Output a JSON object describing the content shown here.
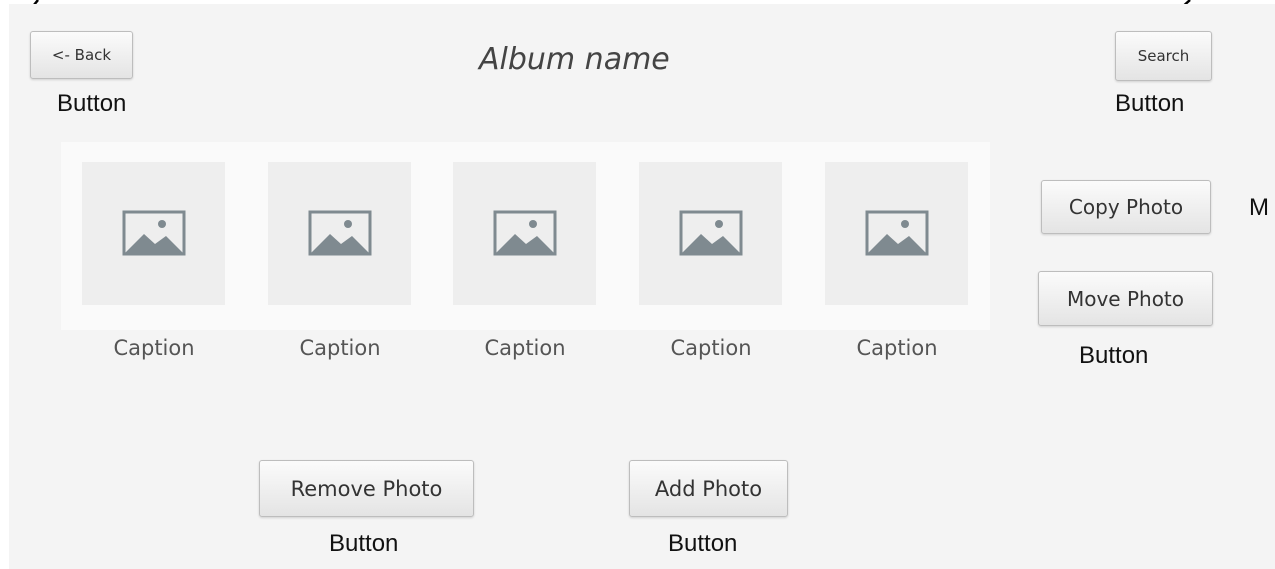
{
  "header": {
    "back_label": "<- Back",
    "title": "Album name",
    "search_label": "Search"
  },
  "photos": [
    {
      "caption": "Caption"
    },
    {
      "caption": "Caption"
    },
    {
      "caption": "Caption"
    },
    {
      "caption": "Caption"
    },
    {
      "caption": "Caption"
    }
  ],
  "actions": {
    "copy_label": "Copy Photo",
    "move_label": "Move Photo",
    "remove_label": "Remove Photo",
    "add_label": "Add Photo"
  },
  "annotations": {
    "back": "Button",
    "search": "Button",
    "copy_move": "Button",
    "remove": "Button",
    "add": "Button",
    "right_edge": "M"
  },
  "icons": {
    "thumbnail": "image-placeholder-icon"
  },
  "colors": {
    "background": "#f4f4f4",
    "strip": "#fafafa",
    "thumbnail": "#eeeeee",
    "icon": "#7f8a90"
  }
}
